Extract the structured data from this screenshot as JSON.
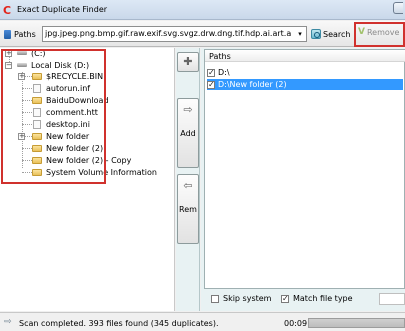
{
  "window": {
    "title": "Exact Duplicate Finder",
    "app_icon": "C"
  },
  "toolbar": {
    "paths_label": "Paths",
    "extensions_value": "jpg.jpeg.png.bmp.gif.raw.exif.svg.svgz.drw.dng.tif.hdp.ai.art.a",
    "dropdown_arrow": "▾",
    "search_label": "Search",
    "remove_label": "Remove",
    "remove_glyph": "V"
  },
  "tree": {
    "items": [
      {
        "label": "(C:)",
        "kind": "drive"
      },
      {
        "label": "Local Disk (D:)",
        "kind": "drive"
      },
      {
        "label": "$RECYCLE.BIN",
        "kind": "folder"
      },
      {
        "label": "autorun.inf",
        "kind": "file"
      },
      {
        "label": "BaiduDownload",
        "kind": "folder"
      },
      {
        "label": "comment.htt",
        "kind": "file"
      },
      {
        "label": "desktop.ini",
        "kind": "file"
      },
      {
        "label": "New folder",
        "kind": "folder"
      },
      {
        "label": "New folder (2)",
        "kind": "folder"
      },
      {
        "label": "New folder (2) - Copy",
        "kind": "folder"
      },
      {
        "label": "System Volume Information",
        "kind": "folder"
      }
    ],
    "expand_plus": "+",
    "expand_minus": "−"
  },
  "side_buttons": {
    "add_glyph": "✚",
    "add_arrow_glyph": "⇨",
    "add_label": "Add",
    "remove_arrow_glyph": "⇦",
    "remove_label": "Rem"
  },
  "paths_panel": {
    "header": "Paths",
    "rows": [
      {
        "label": "D:\\",
        "checked": true,
        "selected": false
      },
      {
        "label": "D:\\New folder (2)",
        "checked": true,
        "selected": true
      }
    ],
    "skip_system_label": "Skip system",
    "match_file_type_label": "Match file type"
  },
  "status": {
    "message": "Scan completed. 393 files found (345 duplicates).",
    "elapsed": "00:09",
    "arrow_glyph": "⇨"
  },
  "colors": {
    "highlight_red": "#d0312d",
    "selection_blue": "#3399ff",
    "panel_teal": "#e8f2f3"
  }
}
